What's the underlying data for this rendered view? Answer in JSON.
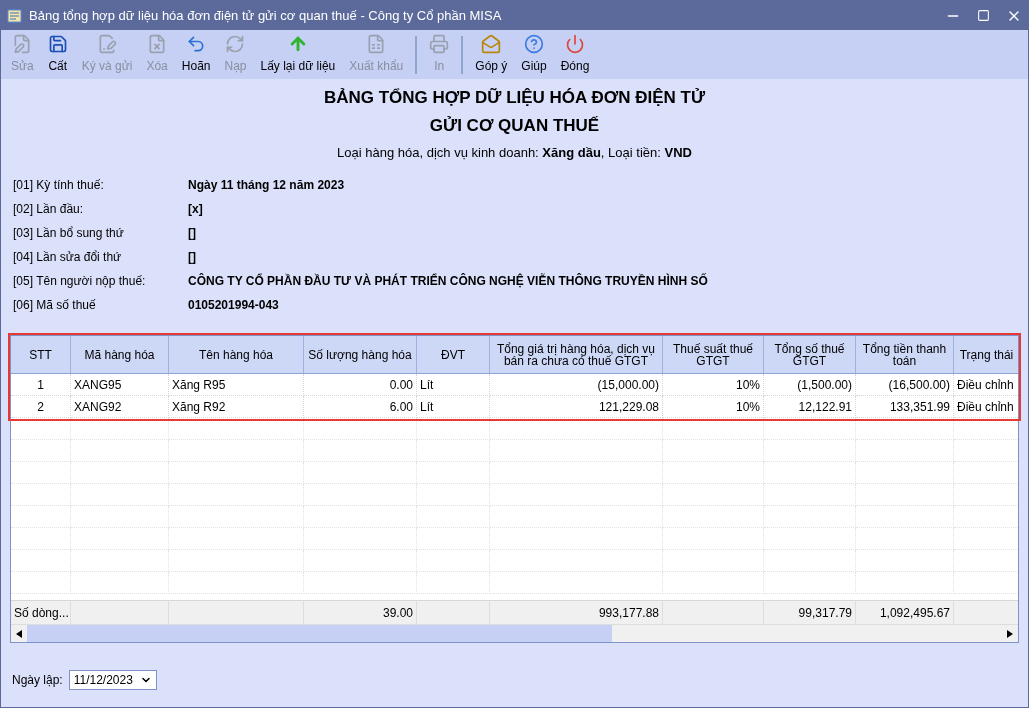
{
  "window": {
    "title": "Bảng tổng hợp dữ liệu hóa đơn điện tử gửi cơ quan thuế - Công ty Cổ phần MISA"
  },
  "toolbar": [
    {
      "label": "Sửa",
      "kind": "edit",
      "disabled": true,
      "separator_before": false
    },
    {
      "label": "Cất",
      "kind": "save",
      "disabled": false,
      "separator_before": false
    },
    {
      "label": "Ký và gửi",
      "kind": "sign",
      "disabled": true,
      "separator_before": false
    },
    {
      "label": "Xóa",
      "kind": "delete",
      "disabled": true,
      "separator_before": false
    },
    {
      "label": "Hoãn",
      "kind": "undo",
      "disabled": false,
      "separator_before": false
    },
    {
      "label": "Nạp",
      "kind": "reload",
      "disabled": true,
      "separator_before": false
    },
    {
      "label": "Lấy lại dữ liệu",
      "kind": "fetch",
      "disabled": false,
      "separator_before": false
    },
    {
      "label": "Xuất khẩu",
      "kind": "export",
      "disabled": true,
      "separator_before": false
    },
    {
      "label": "In",
      "kind": "print",
      "disabled": true,
      "separator_before": true
    },
    {
      "label": "Góp ý",
      "kind": "feedback",
      "disabled": false,
      "separator_before": true
    },
    {
      "label": "Giúp",
      "kind": "help",
      "disabled": false,
      "separator_before": false
    },
    {
      "label": "Đóng",
      "kind": "close",
      "disabled": false,
      "separator_before": false
    }
  ],
  "heading": [
    "BẢNG TỔNG HỢP DỮ LIỆU HÓA ĐƠN ĐIỆN TỬ",
    "GỬI CƠ QUAN THUẾ"
  ],
  "subtitle": "Loại hàng hóa, dịch vụ kinh doanh: **Xăng dầu**, Loại tiền: **VND**",
  "info": [
    {
      "label": "[01] Kỳ tính thuế:",
      "value": "Ngày 11 tháng 12 năm 2023"
    },
    {
      "label": "[02] Lần đầu:",
      "value": "[x]"
    },
    {
      "label": "[03] Lần bổ sung thứ",
      "value": "[]"
    },
    {
      "label": "[04] Lần sửa đổi thứ",
      "value": "[]"
    },
    {
      "label": "[05] Tên người nộp thuế:",
      "value": "CÔNG TY CỔ PHẦN ĐẦU TƯ VÀ PHÁT TRIỂN CÔNG NGHỆ VIỄN THÔNG TRUYỀN HÌNH SỐ"
    },
    {
      "label": "[06] Mã số thuế",
      "value": "0105201994-043"
    }
  ],
  "table": {
    "highlighted": true,
    "columns": [
      "STT",
      "Mã hàng hóa",
      "Tên hàng hóa",
      "Số lượng hàng hóa",
      "ĐVT",
      "Tổng giá trị hàng hóa, dịch vụ bán ra chưa có thuế GTGT",
      "Thuế suất thuế GTGT",
      "Tổng số thuế GTGT",
      "Tổng tiền thanh toán",
      "Trạng thái"
    ],
    "rows": [
      [
        "1",
        "XANG95",
        "Xăng R95",
        "0.00",
        "Lít",
        "(15,000.00)",
        "10%",
        "(1,500.00)",
        "(16,500.00)",
        "Điều chỉnh"
      ],
      [
        "2",
        "XANG92",
        "Xăng R92",
        "6.00",
        "Lít",
        "121,229.08",
        "10%",
        "12,122.91",
        "133,351.99",
        "Điều chỉnh"
      ]
    ],
    "footer": [
      "Số dòng...",
      "39.00",
      "993,177.88",
      "99,317.79",
      "1,092,495.67"
    ]
  },
  "date_field": {
    "label": "Ngày lập:",
    "value": "11/12/2023"
  }
}
